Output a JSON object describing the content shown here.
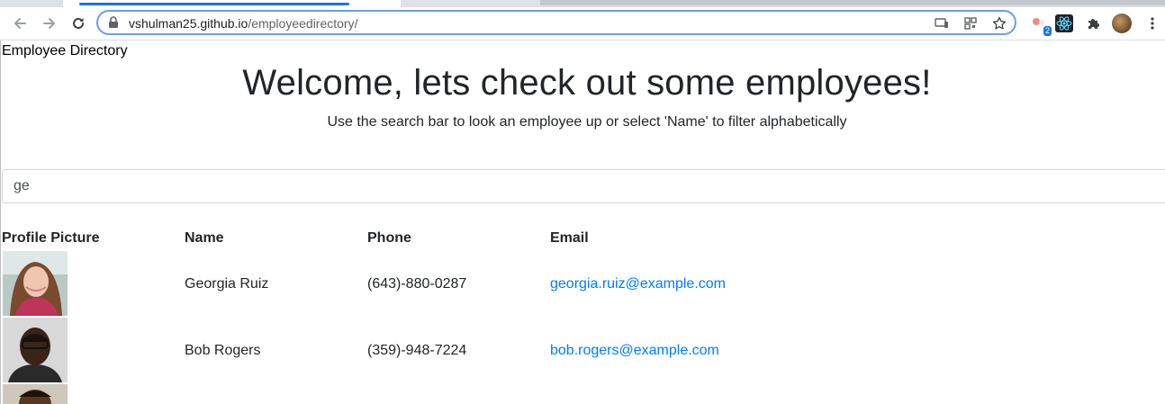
{
  "browser": {
    "url_host": "vshulman25.github.io",
    "url_path": "/employeedirectory/",
    "extension_badge": "2"
  },
  "page": {
    "brand": "Employee Directory",
    "title": "Welcome, lets check out some employees!",
    "subtitle": "Use the search bar to look an employee up or select 'Name' to filter alphabetically",
    "search_value": "ge"
  },
  "table": {
    "headers": [
      "Profile Picture",
      "Name",
      "Phone",
      "Email"
    ],
    "rows": [
      {
        "name": "Georgia Ruiz",
        "phone": "(643)-880-0287",
        "email": "georgia.ruiz@example.com"
      },
      {
        "name": "Bob Rogers",
        "phone": "(359)-948-7224",
        "email": "bob.rogers@example.com"
      }
    ]
  },
  "colors": {
    "link": "#007bff",
    "text": "#212529",
    "omnibox_border": "#6c9ee8"
  }
}
